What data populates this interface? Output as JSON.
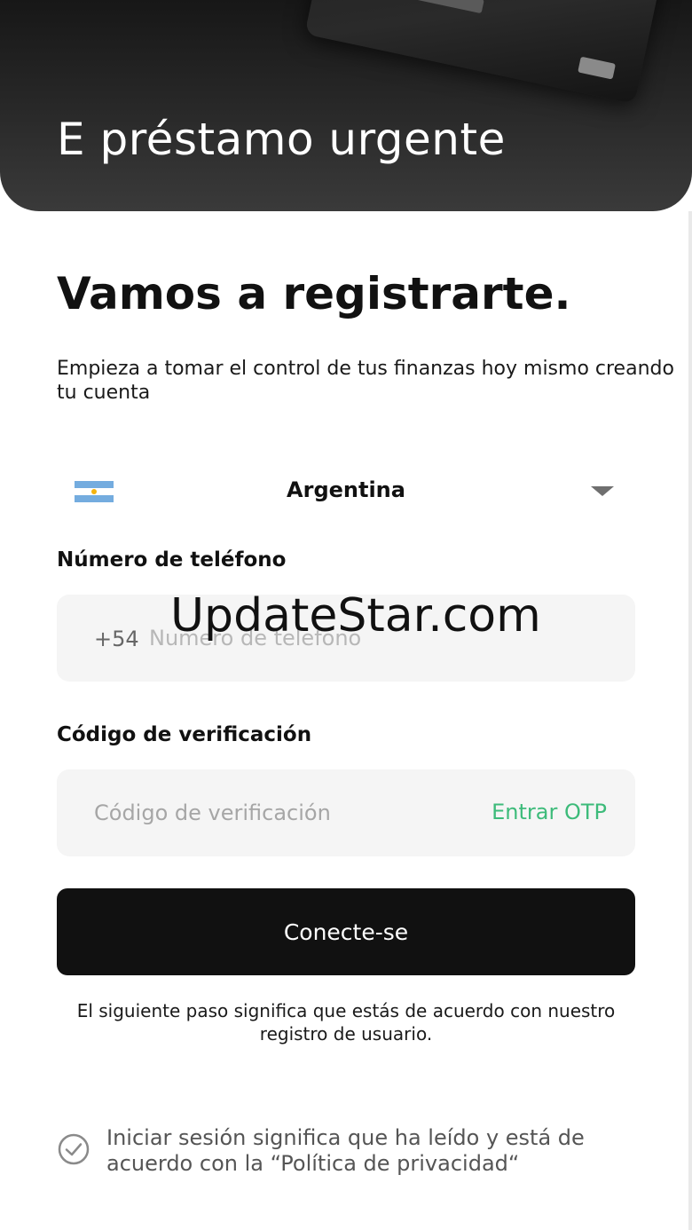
{
  "header": {
    "title": "E préstamo urgente"
  },
  "main": {
    "title": "Vamos a registrarte.",
    "subtitle": "Empieza a tomar el control de tus finanzas hoy mismo creando tu cuenta"
  },
  "country": {
    "selected": "Argentina",
    "flag_icon": "argentina-flag-icon"
  },
  "phone": {
    "label": "Número de teléfono",
    "prefix": "+54",
    "placeholder": "Numero de telefono",
    "value": ""
  },
  "verification": {
    "label": "Código de verificación",
    "placeholder": "Código de verificación",
    "value": "",
    "otp_link": "Entrar OTP"
  },
  "actions": {
    "connect_label": "Conecte-se"
  },
  "terms_note": "El siguiente paso significa que estás de acuerdo con nuestro registro de usuario.",
  "privacy": {
    "text": "Iniciar sesión significa que ha leído y está de acuerdo con la “Política de privacidad“",
    "checked": true
  },
  "watermark": "UpdateStar.com",
  "colors": {
    "accent_green": "#3dbb7a",
    "primary_button": "#111111",
    "input_background": "#f5f5f5"
  }
}
